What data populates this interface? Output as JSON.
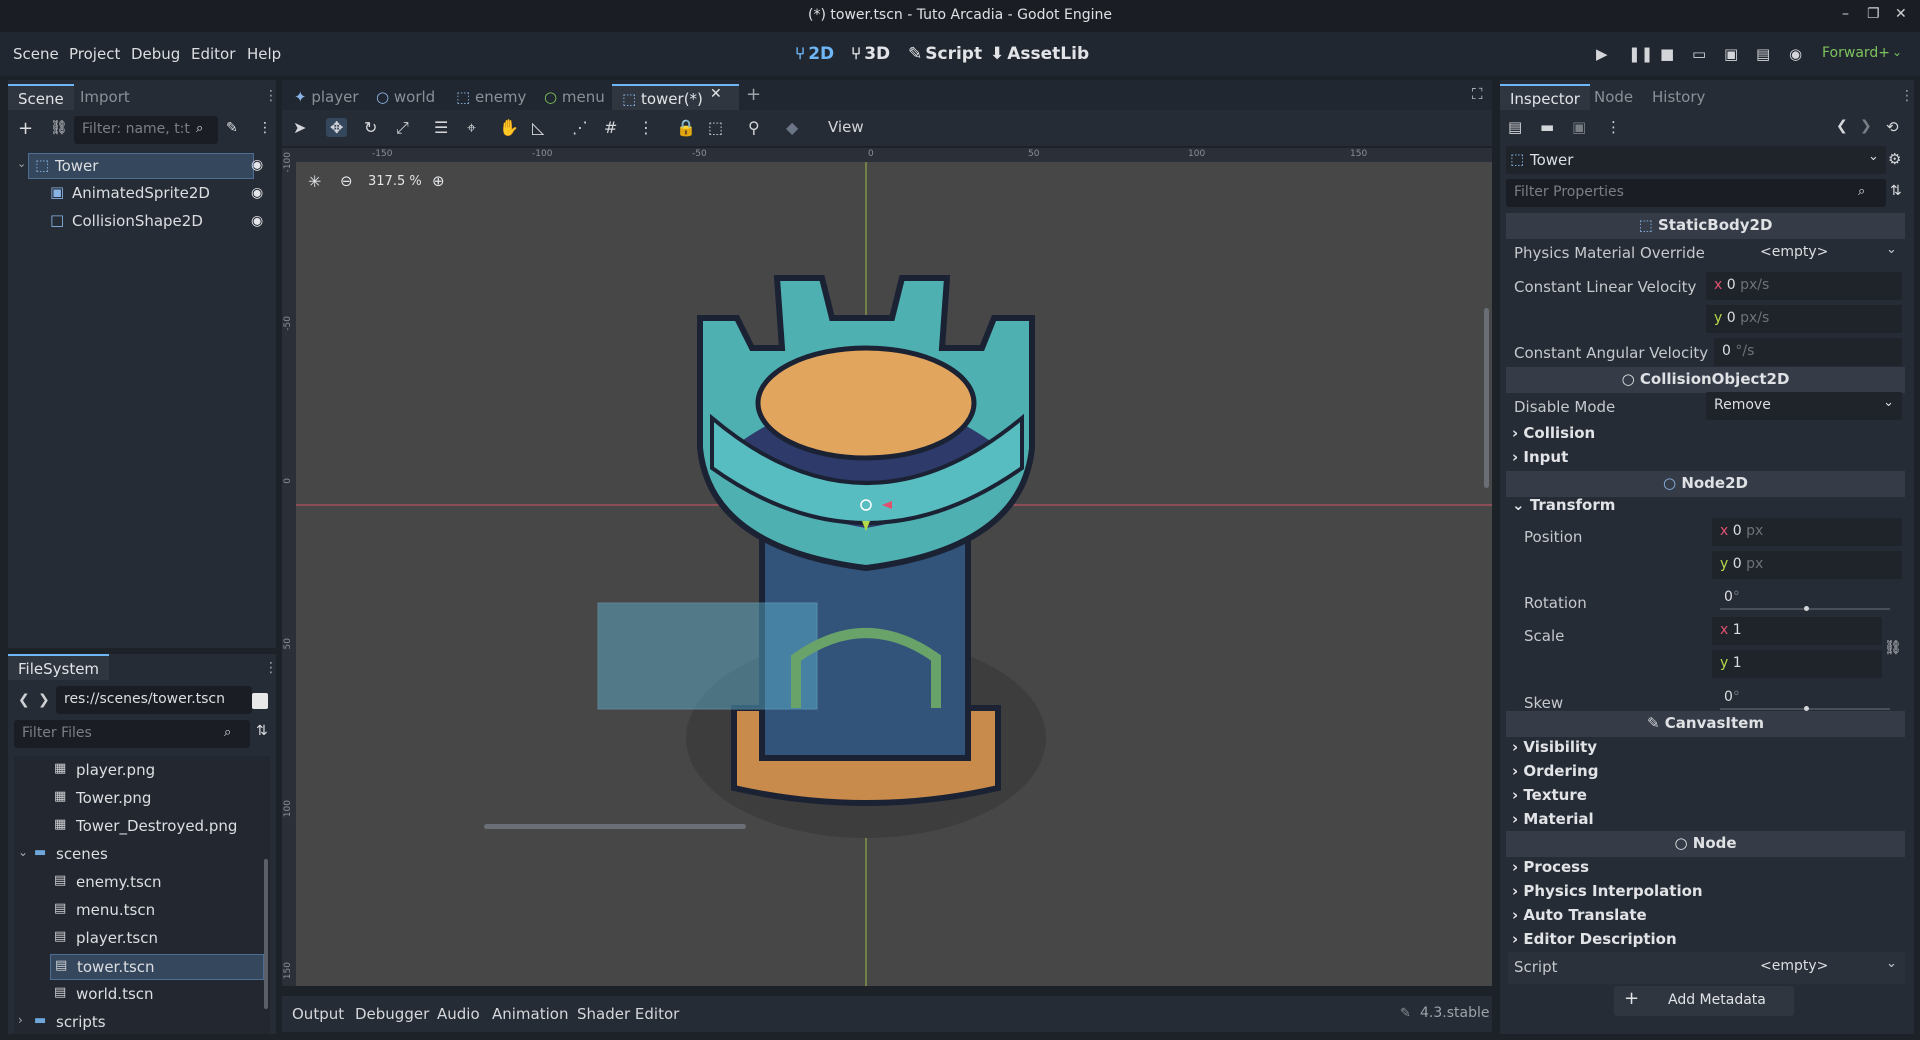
{
  "window": {
    "title": "(*) tower.tscn - Tuto Arcadia - Godot Engine",
    "controls": [
      "–",
      "❐",
      "✕"
    ]
  },
  "menubar": {
    "items": [
      "Scene",
      "Project",
      "Debug",
      "Editor",
      "Help"
    ]
  },
  "workspaces": [
    {
      "label": "2D",
      "icon": "⑂",
      "active": true
    },
    {
      "label": "3D",
      "icon": "⑂",
      "active": false
    },
    {
      "label": "Script",
      "icon": "✎",
      "active": false
    },
    {
      "label": "AssetLib",
      "icon": "⬇",
      "active": false
    }
  ],
  "renderer": "Forward+",
  "scene_dock": {
    "tabs": [
      "Scene",
      "Import"
    ],
    "filter_placeholder": "Filter: name, t:t",
    "nodes": [
      {
        "label": "Tower",
        "icon": "⬚",
        "selected": true
      },
      {
        "label": "AnimatedSprite2D",
        "icon": "▣",
        "selected": false
      },
      {
        "label": "CollisionShape2D",
        "icon": "□",
        "selected": false
      }
    ]
  },
  "filesystem": {
    "tab": "FileSystem",
    "path": "res://scenes/tower.tscn",
    "filter_placeholder": "Filter Files",
    "items": [
      {
        "label": "player.png",
        "icon": "▦",
        "indent": 2
      },
      {
        "label": "Tower.png",
        "icon": "▦",
        "indent": 2
      },
      {
        "label": "Tower_Destroyed.png",
        "icon": "▦",
        "indent": 2
      },
      {
        "label": "scenes",
        "icon": "▬",
        "indent": 1,
        "folder": true,
        "open": true
      },
      {
        "label": "enemy.tscn",
        "icon": "▤",
        "indent": 2
      },
      {
        "label": "menu.tscn",
        "icon": "▤",
        "indent": 2
      },
      {
        "label": "player.tscn",
        "icon": "▤",
        "indent": 2
      },
      {
        "label": "tower.tscn",
        "icon": "▤",
        "indent": 2,
        "selected": true
      },
      {
        "label": "world.tscn",
        "icon": "▤",
        "indent": 2
      },
      {
        "label": "scripts",
        "icon": "▬",
        "indent": 1,
        "folder": true,
        "open": false
      }
    ]
  },
  "editor_tabs": [
    {
      "label": "player",
      "icon": "✦"
    },
    {
      "label": "world",
      "icon": "○"
    },
    {
      "label": "enemy",
      "icon": "⬚"
    },
    {
      "label": "menu",
      "icon": "○"
    },
    {
      "label": "tower(*)",
      "icon": "⬚",
      "active": true
    }
  ],
  "toolbar": {
    "view_label": "View"
  },
  "viewport": {
    "zoom": "317.5 %",
    "ruler_h": [
      "-150",
      "-100",
      "-50",
      "0",
      "50",
      "100",
      "150"
    ],
    "ruler_v": [
      "-100",
      "-50",
      "0",
      "50",
      "100",
      "150"
    ]
  },
  "bottom_tabs": [
    "Output",
    "Debugger",
    "Audio",
    "Animation",
    "Shader Editor"
  ],
  "version": "4.3.stable",
  "inspector": {
    "tabs": [
      "Inspector",
      "Node",
      "History"
    ],
    "node_name": "Tower",
    "filter_placeholder": "Filter Properties",
    "sections": {
      "static": "StaticBody2D",
      "collision_obj": "CollisionObject2D",
      "node2d": "Node2D",
      "canvas": "CanvasItem",
      "node": "Node"
    },
    "props": {
      "physics_material": {
        "label": "Physics Material Override",
        "value": "<empty>"
      },
      "linear_velocity": {
        "label": "Constant Linear Velocity",
        "x": "0",
        "y": "0",
        "unit": "px/s"
      },
      "angular_velocity": {
        "label": "Constant Angular Velocity",
        "value": "0",
        "unit": "°/s"
      },
      "disable_mode": {
        "label": "Disable Mode",
        "value": "Remove"
      },
      "position": {
        "label": "Position",
        "x": "0",
        "y": "0",
        "unit": "px"
      },
      "rotation": {
        "label": "Rotation",
        "value": "0",
        "unit": "°"
      },
      "scale": {
        "label": "Scale",
        "x": "1",
        "y": "1"
      },
      "skew": {
        "label": "Skew",
        "value": "0",
        "unit": "°"
      },
      "script": {
        "label": "Script",
        "value": "<empty>"
      }
    },
    "groups": {
      "collision": "Collision",
      "input": "Input",
      "transform": "Transform",
      "visibility": "Visibility",
      "ordering": "Ordering",
      "texture": "Texture",
      "material": "Material",
      "process": "Process",
      "physics_interp": "Physics Interpolation",
      "auto_translate": "Auto Translate",
      "editor_desc": "Editor Description"
    },
    "add_metadata": "Add Metadata"
  },
  "colors": {
    "accent": "#6fb6f6",
    "background": "#1d2229",
    "panel": "#262c35",
    "canvas": "#474747"
  }
}
